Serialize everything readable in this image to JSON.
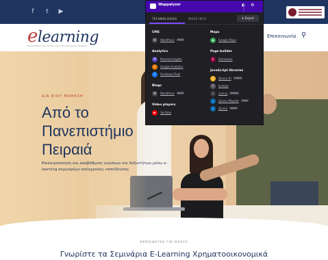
{
  "social": {
    "icons": [
      "facebook-icon",
      "twitter-icon",
      "youtube-icon"
    ],
    "glyphs": [
      "f",
      "t",
      "▶"
    ]
  },
  "header": {
    "logo_initial": "e",
    "logo_rest": "learning",
    "logo_sub": "Επιμόρφωση και Κατάρτιση Πανεπιστημίου Πειραιά",
    "nav_contact": "Επικοινωνία",
    "search_glyph": "⚲"
  },
  "hero": {
    "kicker": "ΔΙΑ ΒΙΟΥ ΜΑΘΗΣΗ",
    "title_line1": "Από το",
    "title_line2": "Πανεπιστήμιο",
    "title_line3": "Πειραιά",
    "subtitle": "Επικαιροποίηση και αναβάθμιση γνώσεων και δεξιοτήτων μέσω e-learning σεμιναρίων ασύγχρονης εκπαίδευσης"
  },
  "education": {
    "kicker": "ΕΚΠΑΙΔΕΥΣΗ ΓΙΑ ΟΛΟΥΣ",
    "title": "Γνωρίστε τα Σεμινάρια E-Learning Χρηματοοικονομικά"
  },
  "wappalyzer": {
    "brand": "Wappalyzer",
    "controls": "◐ ⚙ ⋮",
    "tabs": {
      "technologies": "TECHNOLOGIES",
      "more_info": "MORE INFO"
    },
    "export_label": "⬇ Export",
    "left_column": [
      {
        "category": "CMS",
        "items": [
          {
            "name": "WordPress",
            "tag": "6.0.2",
            "icon_color": "#464646",
            "icon_glyph": "W"
          }
        ]
      },
      {
        "category": "Analytics",
        "items": [
          {
            "name": "MonsterInsights",
            "tag": "",
            "icon_color": "#5a3fc0",
            "icon_glyph": "M"
          },
          {
            "name": "Google Analytics",
            "tag": "",
            "icon_color": "#e37400",
            "icon_glyph": "G"
          },
          {
            "name": "Facebook Pixel",
            "tag": "",
            "icon_color": "#1877f2",
            "icon_glyph": "f"
          }
        ]
      },
      {
        "category": "Blogs",
        "items": [
          {
            "name": "WordPress",
            "tag": "6.0.2",
            "icon_color": "#464646",
            "icon_glyph": "W"
          }
        ]
      },
      {
        "category": "Video players",
        "items": [
          {
            "name": "YouTube",
            "tag": "",
            "icon_color": "#ff0000",
            "icon_glyph": "▶"
          }
        ]
      }
    ],
    "right_column": [
      {
        "category": "Maps",
        "items": [
          {
            "name": "Google Maps",
            "tag": "",
            "icon_color": "#34a853",
            "icon_glyph": "◉"
          }
        ]
      },
      {
        "category": "Page builder",
        "items": [
          {
            "name": "Elementor",
            "tag": "",
            "icon_color": "#92003b",
            "icon_glyph": "E"
          }
        ]
      },
      {
        "category": "JavaScript libraries",
        "items": [
          {
            "name": "jQuery UI",
            "tag": "1.13.2",
            "icon_color": "#f0b429",
            "icon_glyph": "j"
          },
          {
            "name": "Isotope",
            "tag": "",
            "icon_color": "#5a5a62",
            "icon_glyph": "I"
          },
          {
            "name": "core-js",
            "tag": "3.25.0",
            "icon_color": "#3a3a40",
            "icon_glyph": "c"
          },
          {
            "name": "jQuery Migrate",
            "tag": "3.3.2",
            "icon_color": "#0769ad",
            "icon_glyph": "j"
          },
          {
            "name": "jQuery",
            "tag": "3.6.0",
            "icon_color": "#0769ad",
            "icon_glyph": "j"
          }
        ]
      }
    ]
  }
}
